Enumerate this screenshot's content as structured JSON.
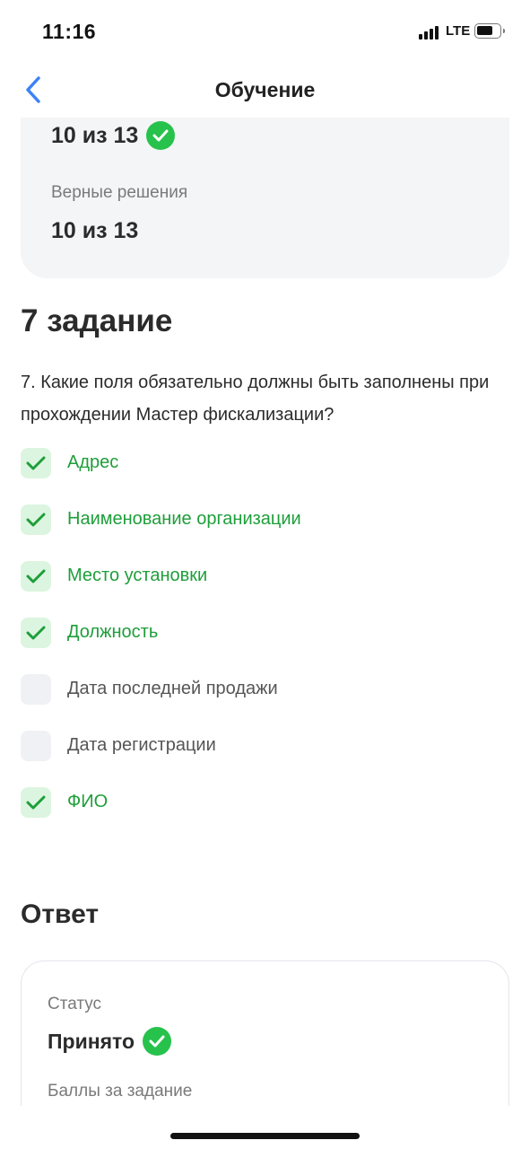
{
  "status_bar": {
    "time": "11:16",
    "network": "LTE"
  },
  "nav": {
    "title": "Обучение",
    "back_icon": "chevron-left-icon"
  },
  "stats": {
    "score_value": "10 из 13",
    "correct_label": "Верные решения",
    "correct_value": "10 из 13"
  },
  "task": {
    "title": "7 задание",
    "question": "7. Какие поля обязательно должны быть заполнены при прохождении Мастер фискализации?",
    "options": [
      {
        "label": "Адрес",
        "checked": true
      },
      {
        "label": "Наименование организации",
        "checked": true
      },
      {
        "label": "Место установки",
        "checked": true
      },
      {
        "label": "Должность",
        "checked": true
      },
      {
        "label": "Дата последней продажи",
        "checked": false
      },
      {
        "label": "Дата регистрации",
        "checked": false
      },
      {
        "label": "ФИО",
        "checked": true
      }
    ]
  },
  "answer": {
    "title": "Ответ",
    "status_label": "Статус",
    "status_value": "Принято",
    "points_label": "Баллы за задание"
  },
  "colors": {
    "accent_blue": "#3b82f6",
    "success_green": "#27c24c",
    "correct_text": "#1e9e3a",
    "checked_bg": "#dcf5e0",
    "unchecked_bg": "#eff1f5",
    "card_bg": "#f4f5f7"
  }
}
